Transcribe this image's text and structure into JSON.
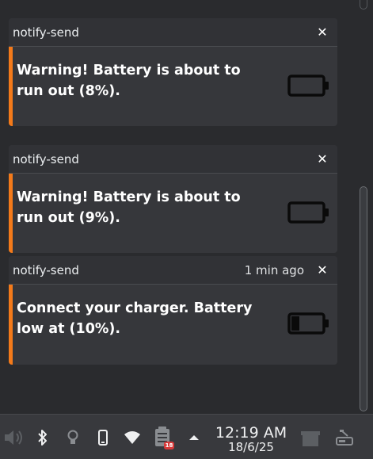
{
  "notifications": [
    {
      "app": "notify-send",
      "time": "",
      "message": "Warning! Battery is about to run out (8%).",
      "battery_level": 0.08,
      "icon": "battery-empty-icon"
    },
    {
      "app": "notify-send",
      "time": "",
      "message": "Warning! Battery is about to run out (9%).",
      "battery_level": 0.09,
      "icon": "battery-empty-icon"
    },
    {
      "app": "notify-send",
      "time": "1 min ago",
      "message": "Connect your charger. Battery low at (10%).",
      "battery_level": 0.1,
      "icon": "battery-low-icon"
    }
  ],
  "taskbar": {
    "clock_time": "12:19 AM",
    "clock_date": "18/6/25",
    "notification_badge": "18",
    "tray_icons": [
      "volume-muted-icon",
      "bluetooth-icon",
      "lightbulb-icon",
      "phone-icon",
      "wifi-icon",
      "notes-icon",
      "tray-expand-icon",
      "desktop-icon",
      "settings-toggle-icon"
    ]
  },
  "colors": {
    "accent": "#f47a1a",
    "background": "#2a2b2e",
    "card": "#36373b",
    "badge": "#d83a3a"
  }
}
